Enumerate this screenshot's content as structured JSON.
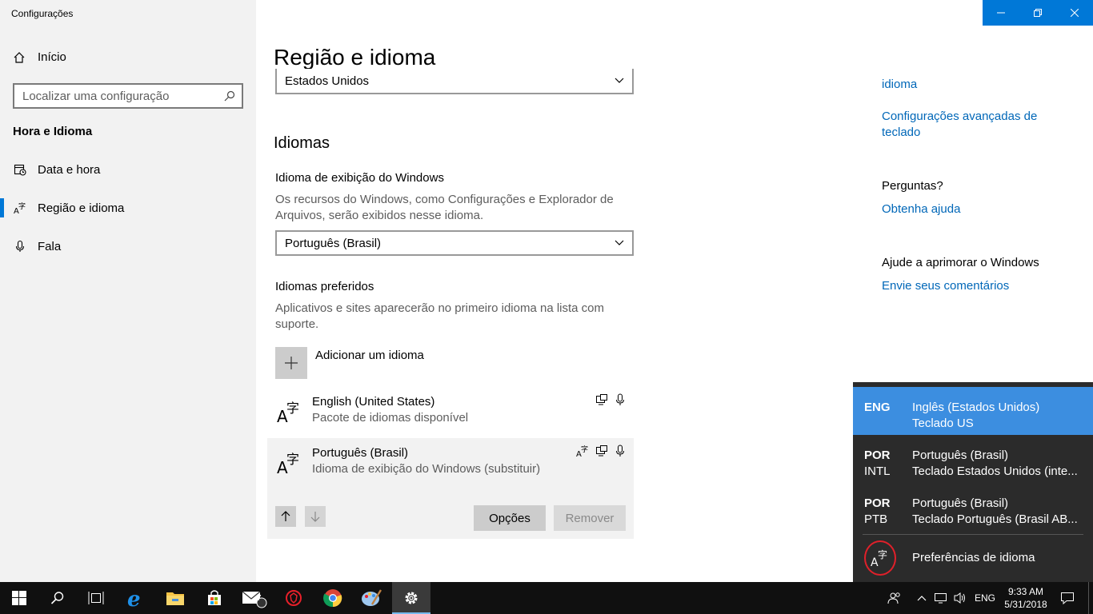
{
  "window": {
    "title": "Configurações"
  },
  "sidebar": {
    "home_label": "Início",
    "search_placeholder": "Localizar uma configuração",
    "section_title": "Hora e Idioma",
    "items": [
      {
        "label": "Data e hora",
        "icon": "calendar-clock-icon"
      },
      {
        "label": "Região e idioma",
        "icon": "language-icon",
        "active": true
      },
      {
        "label": "Fala",
        "icon": "microphone-icon"
      }
    ]
  },
  "main": {
    "title": "Região e idioma",
    "country_value": "Estados Unidos",
    "languages_heading": "Idiomas",
    "display_lang_label": "Idioma de exibição do Windows",
    "display_lang_desc": "Os recursos do Windows, como Configurações e Explorador de Arquivos, serão exibidos nesse idioma.",
    "display_lang_value": "Português (Brasil)",
    "preferred_label": "Idiomas preferidos",
    "preferred_desc": "Aplicativos e sites aparecerão no primeiro idioma na lista com suporte.",
    "add_language": "Adicionar um idioma",
    "languages": [
      {
        "name": "English (United States)",
        "sub": "Pacote de idiomas disponível"
      },
      {
        "name": "Português (Brasil)",
        "sub": "Idioma de exibição do Windows (substituir)"
      }
    ],
    "options_button": "Opções",
    "remove_button": "Remover"
  },
  "right": {
    "link_partial": "idioma",
    "link_keyboard": "Configurações avançadas de teclado",
    "questions_heading": "Perguntas?",
    "help_link": "Obtenha ajuda",
    "improve_heading": "Ajude a aprimorar o Windows",
    "feedback_link": "Envie seus comentários"
  },
  "flyout": {
    "items": [
      {
        "code": "ENG",
        "code2": "",
        "line1": "Inglês (Estados Unidos)",
        "line2": "Teclado US",
        "selected": true
      },
      {
        "code": "POR",
        "code2": "INTL",
        "line1": "Português (Brasil)",
        "line2": "Teclado Estados Unidos (inte..."
      },
      {
        "code": "POR",
        "code2": "PTB",
        "line1": "Português (Brasil)",
        "line2": "Teclado Português (Brasil AB..."
      }
    ],
    "preferences": "Preferências de idioma"
  },
  "taskbar": {
    "lang": "ENG",
    "time": "9:33 AM",
    "date": "5/31/2018",
    "mail_badge": "7"
  },
  "colors": {
    "accent": "#0078d7",
    "link": "#0067b8",
    "flyout_bg": "#2b2b2b",
    "flyout_selected": "#3c8ee0"
  }
}
